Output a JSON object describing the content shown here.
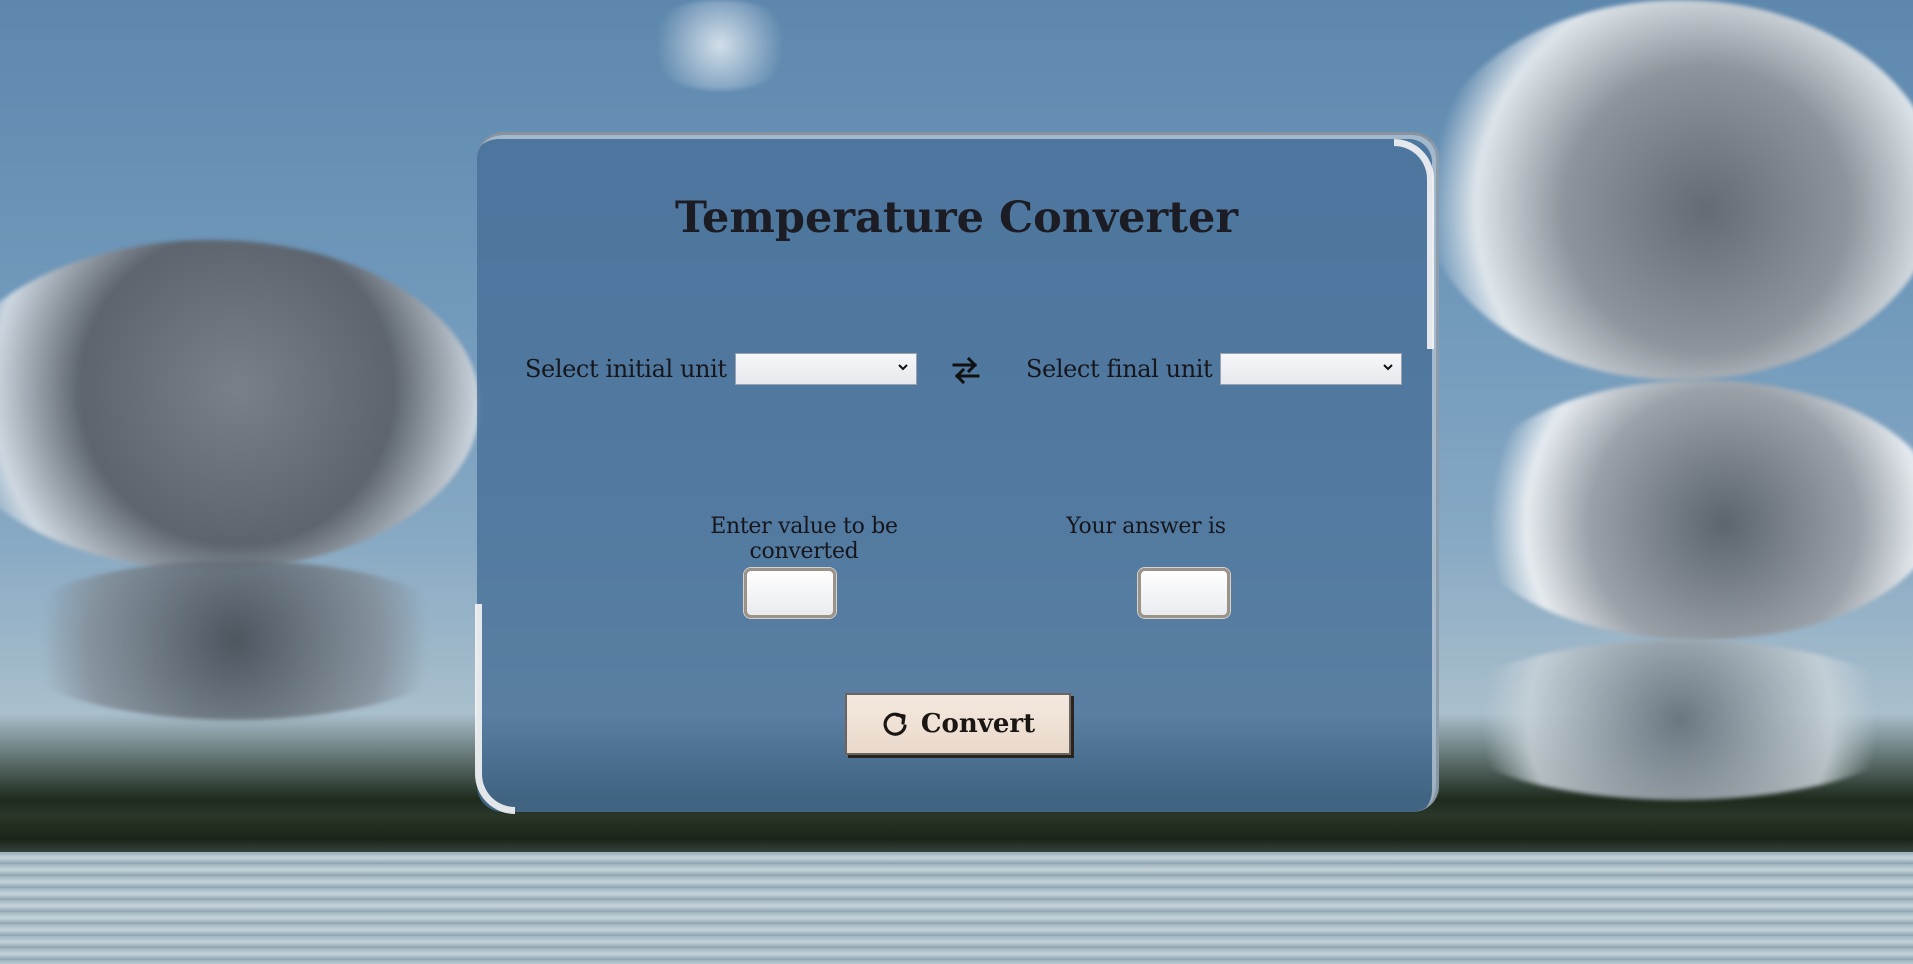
{
  "page": {
    "title": "Temperature Converter"
  },
  "converter": {
    "initial_unit_label": "Select initial unit",
    "initial_unit_value": "",
    "final_unit_label": "Select final unit",
    "final_unit_value": "",
    "value_label": "Enter value to be converted",
    "value_input": "",
    "answer_label": "Your answer is",
    "answer_value": "",
    "convert_label": "Convert"
  },
  "icons": {
    "swap": "swap-arrows-icon",
    "convert": "refresh-icon",
    "dropdown": "chevron-down-icon"
  },
  "colors": {
    "card_bg": "#4a7198",
    "text": "#1c1c24",
    "button_bg": "#f0e3d7"
  }
}
